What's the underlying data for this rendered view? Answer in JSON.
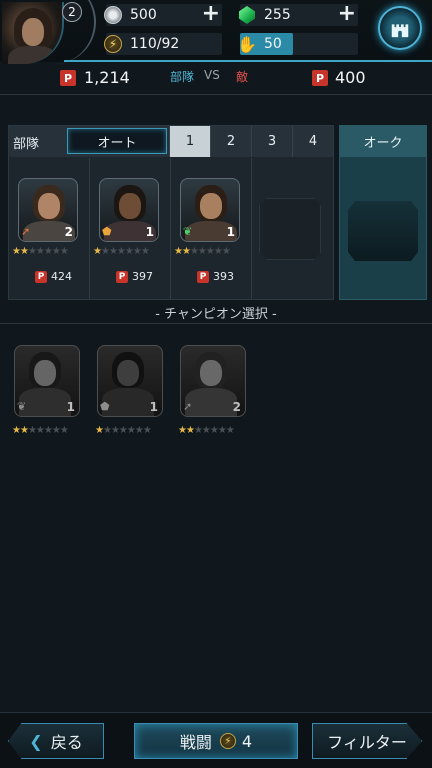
{
  "player": {
    "level": "2"
  },
  "resources": {
    "silver": "500",
    "gems": "255",
    "energy": "110/92",
    "hand_value": "50",
    "hand_fill": 0.45
  },
  "score": {
    "ally_power": "1,214",
    "ally_label": "部隊",
    "vs_label": "VS",
    "enemy_label": "敵",
    "enemy_power": "400",
    "p_glyph": "P"
  },
  "squad": {
    "label": "部隊",
    "auto_label": "オート",
    "slots": [
      "1",
      "2",
      "3",
      "4"
    ],
    "active_slot": 0,
    "heroes": [
      {
        "level": "2",
        "stars": 2,
        "power": "424",
        "class_icon": "arrow-icon"
      },
      {
        "level": "1",
        "stars": 1,
        "power": "397",
        "class_icon": "shield-icon"
      },
      {
        "level": "1",
        "stars": 2,
        "power": "393",
        "class_icon": "leaf-icon"
      }
    ]
  },
  "orc": {
    "label": "オーク"
  },
  "select_title": "- チャンピオン選択 -",
  "roster": [
    {
      "level": "1",
      "stars": 2
    },
    {
      "level": "1",
      "stars": 1
    },
    {
      "level": "2",
      "stars": 2
    }
  ],
  "bottom": {
    "back_label": "戻る",
    "battle_label": "戦闘",
    "battle_cost": "4",
    "filter_label": "フィルター"
  },
  "colors": {
    "accent": "#3ea7c6",
    "badge_red": "#c8332a",
    "star_gold": "#e6b846"
  }
}
